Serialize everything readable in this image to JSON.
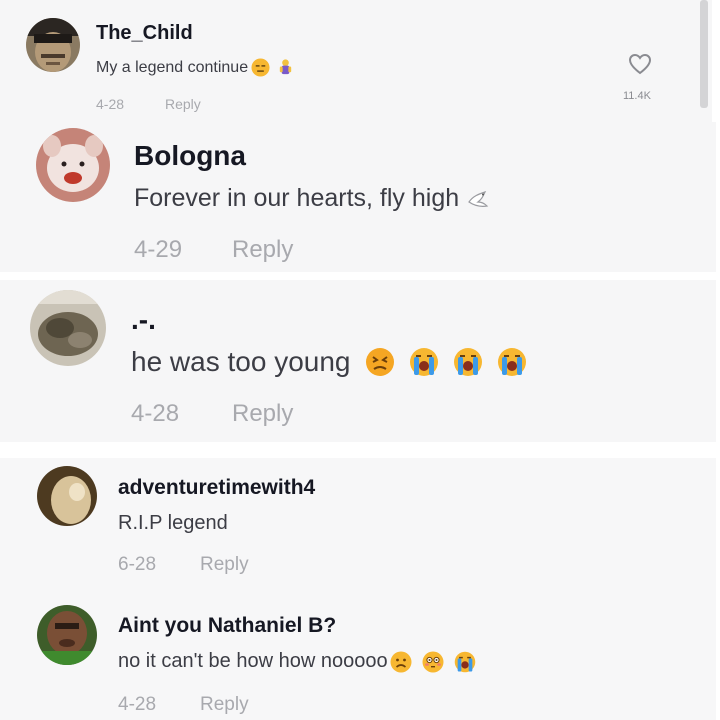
{
  "comments": [
    {
      "username": "The_Child",
      "text": "My a legend continue",
      "emojis": [
        "expressionless-face",
        "man-bowing"
      ],
      "date": "4-28",
      "reply_label": "Reply",
      "like_count": "11.4K"
    },
    {
      "username": "Bologna",
      "text": "Forever in our hearts, fly high",
      "emojis": [
        "dove"
      ],
      "date": "4-29",
      "reply_label": "Reply"
    },
    {
      "username": ".-.",
      "text": "he was too young",
      "emojis": [
        "persevering-face",
        "loudly-crying-face",
        "loudly-crying-face",
        "loudly-crying-face"
      ],
      "date": "4-28",
      "reply_label": "Reply"
    },
    {
      "username": "adventuretimewith4",
      "text": "R.I.P legend",
      "emojis": [],
      "date": "6-28",
      "reply_label": "Reply"
    },
    {
      "username": "Aint you Nathaniel B?",
      "text": "no it can't be how how nooooo",
      "emojis": [
        "frowning-face",
        "flushed-face",
        "loudly-crying-face"
      ],
      "date": "4-28",
      "reply_label": "Reply"
    }
  ],
  "icons": {
    "like": "heart-outline-icon"
  },
  "colors": {
    "panel_bg": "#f6f6f7",
    "username": "#161823",
    "comment_text": "#3c3d45",
    "meta_text": "#a8a9ae",
    "emoji_yellow": "#f7b731",
    "emoji_tears": "#3d9ae8"
  }
}
